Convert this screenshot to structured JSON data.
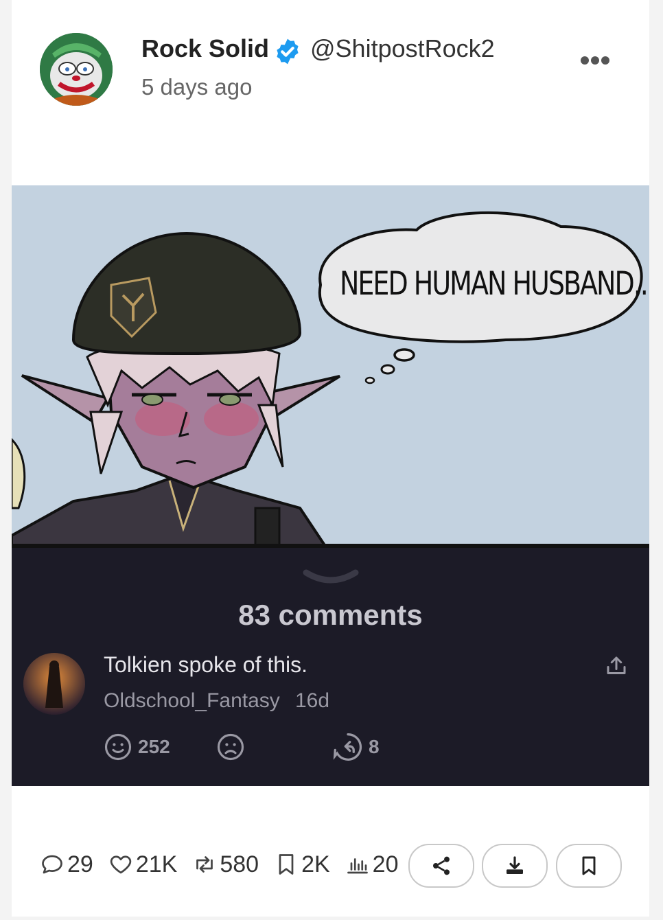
{
  "post": {
    "author_name": "Rock Solid",
    "handle": "@ShitpostRock2",
    "time_ago": "5 days ago"
  },
  "image": {
    "speech_text": "NEED HUMAN HUSBAND..."
  },
  "comments_panel": {
    "count_label": "83 comments",
    "top_comment": {
      "text": "Tolkien spoke of this.",
      "username": "Oldschool_Fantasy",
      "age": "16d",
      "likes": "252",
      "replies": "8"
    }
  },
  "stats": {
    "comments": "29",
    "likes": "21K",
    "reposts": "580",
    "bookmarks": "2K",
    "views": "20"
  },
  "icons": {
    "verified": "verified-badge-icon",
    "more": "more-dots-icon",
    "chevron": "chevron-down-icon",
    "share": "share-icon",
    "download": "download-icon",
    "bookmark": "bookmark-icon"
  },
  "colors": {
    "verified_blue": "#1d9bf0",
    "panel_bg": "#1c1b27",
    "comic_sky": "#c3d2e0"
  }
}
